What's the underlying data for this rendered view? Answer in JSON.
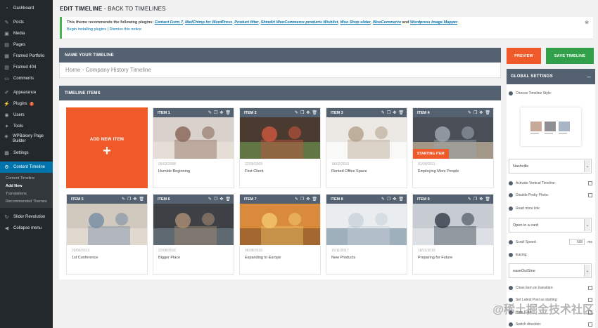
{
  "sidebar": {
    "items": [
      {
        "icon": "dashboard-icon",
        "glyph": "◔",
        "label": "Dashboard"
      },
      {
        "icon": "pin-icon",
        "glyph": "✎",
        "label": "Posts"
      },
      {
        "icon": "media-icon",
        "glyph": "▣",
        "label": "Media"
      },
      {
        "icon": "page-icon",
        "glyph": "▤",
        "label": "Pages"
      },
      {
        "icon": "portfolio-icon",
        "glyph": "▦",
        "label": "Framed Portfolio"
      },
      {
        "icon": "page404-icon",
        "glyph": "▥",
        "label": "Framed 404"
      },
      {
        "icon": "comment-icon",
        "glyph": "▭",
        "label": "Comments"
      },
      {
        "icon": "brush-icon",
        "glyph": "✐",
        "label": "Appearance"
      },
      {
        "icon": "plugin-icon",
        "glyph": "⚡",
        "label": "Plugins",
        "badge": "2"
      },
      {
        "icon": "users-icon",
        "glyph": "◉",
        "label": "Users"
      },
      {
        "icon": "tools-icon",
        "glyph": "✦",
        "label": "Tools"
      },
      {
        "icon": "wpbakery-icon",
        "glyph": "◈",
        "label": "WPBakery Page Builder"
      },
      {
        "icon": "settings-icon",
        "glyph": "▩",
        "label": "Settings"
      },
      {
        "icon": "gear-icon",
        "glyph": "⚙",
        "label": "Content Timeline"
      }
    ],
    "submenu": [
      "Content Timeline",
      "Add New",
      "Translations",
      "Recommended Themes"
    ],
    "after": [
      {
        "icon": "slider-icon",
        "glyph": "↻",
        "label": "Slider Revolution"
      },
      {
        "icon": "collapse-icon",
        "glyph": "◀",
        "label": "Collapse menu"
      }
    ]
  },
  "header": {
    "title": "EDIT TIMELINE",
    "separator": " - ",
    "back": "BACK TO TIMELINES"
  },
  "notice": {
    "text": "This theme recommends the following plugins: ",
    "plugins": [
      "Contact Form 7",
      "MailChimp for WordPress",
      "Product filter",
      "Shindiri WooCommerce products Wishlist",
      "Woo Shop slider",
      "WooCommerce"
    ],
    "and": " and ",
    "last": "Wordpress Image Mapper",
    "begin": "Begin installing plugins",
    "sep": " | ",
    "dismiss": "Dismiss this notice",
    "close": "⊗"
  },
  "name_section": {
    "header": "NAME YOUR TIMELINE",
    "value": "Home - Company History Timeline"
  },
  "items_section": {
    "header": "TIMELINE ITEMS",
    "add_new": "ADD NEW ITEM",
    "plus": "+",
    "items": [
      {
        "label": "ITEM 1",
        "date": "05/02/2008",
        "title": "Humble Beginning"
      },
      {
        "label": "ITEM 2",
        "date": "22/09/2009",
        "title": "First Client"
      },
      {
        "label": "ITEM 3",
        "date": "18/02/2010",
        "title": "Rented Office Space"
      },
      {
        "label": "ITEM 4",
        "date": "01/09/2011",
        "title": "Employing More People",
        "badge": "STARTING ITEM"
      },
      {
        "label": "ITEM 5",
        "date": "20/06/2013",
        "title": "1st Conference"
      },
      {
        "label": "ITEM 6",
        "date": "22/08/2016",
        "title": "Bigger Place"
      },
      {
        "label": "ITEM 7",
        "date": "06/08/2016",
        "title": "Expanding to Europe"
      },
      {
        "label": "ITEM 8",
        "date": "15/11/2017",
        "title": "New Products"
      },
      {
        "label": "ITEM 9",
        "date": "18/11/2019",
        "title": "Preparing for Future"
      }
    ]
  },
  "buttons": {
    "preview": "PREVIEW",
    "save": "SAVE TIMELINE"
  },
  "global_settings": {
    "header": "GLOBAL SETTINGS",
    "collapse": "–",
    "choose_style": "Choose Timeline Style:",
    "style_value": "Nashville",
    "activate_vertical": "Activate Vertical Timeline:",
    "disable_pretty": "Disable Pretty Photo:",
    "read_more": "Read more link:",
    "read_more_value": "Open in a card",
    "scroll_speed": "Scroll Speed:",
    "scroll_speed_value": "500",
    "scroll_unit": "ms",
    "easing": "Easing:",
    "easing_value": "easeOutSine",
    "close_item": "Close item on transition:",
    "set_latest": "Set Latest Post as starting:",
    "hide_date": "Hide Date:",
    "switch_direction": "Switch direction:"
  },
  "watermark": "@稀土掘金技术社区"
}
